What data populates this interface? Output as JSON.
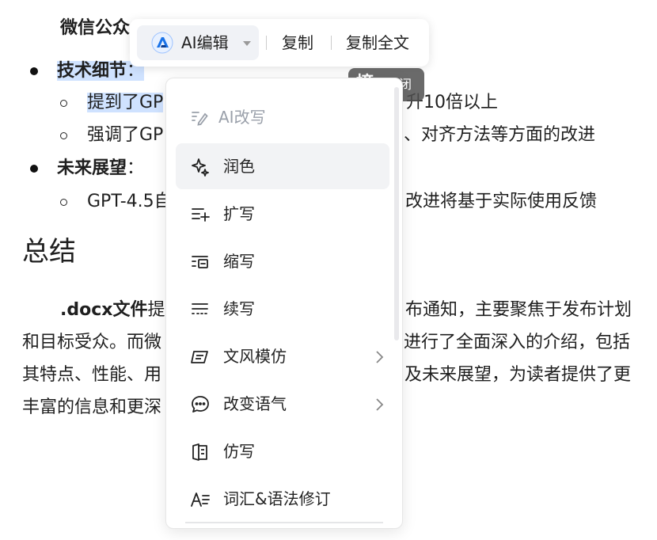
{
  "document": {
    "heading_fragment": "微信公众",
    "bullets": [
      {
        "label": "技术细节",
        "sep": "："
      },
      {
        "label": "未来展望",
        "sep": "："
      }
    ],
    "sub_items": {
      "s1_left": "提到了GP",
      "s1_right": "升10倍以上",
      "s2_left": "强调了GP",
      "s2_right": "、对齐方法等方面的改进",
      "s3_left": "GPT-4.5自",
      "s3_right": "改进将基于实际使用反馈"
    },
    "summary_title": "总结",
    "paragraph": {
      "l1_bold": ".docx文件",
      "l1_mid": "提",
      "l1_right": "布通知，主要聚焦于发布计划",
      "l2_left": "和目标受众。而微",
      "l2_right": "进行了全面深入的介绍，包括",
      "l3_left": "其特点、性能、用",
      "l3_right": "及未来展望，为读者提供了更",
      "l4_left": "丰富的信息和更深"
    }
  },
  "toolbar": {
    "ai_edit_label": "AI编辑",
    "copy_label": "复制",
    "copy_all_label": "复制全文"
  },
  "close_tag": {
    "icon_char": "摘",
    "label": "关闭"
  },
  "menu": {
    "header": "AI改写",
    "items": [
      {
        "label": "润色",
        "icon": "sparkle-icon"
      },
      {
        "label": "扩写",
        "icon": "expand-lines-icon"
      },
      {
        "label": "缩写",
        "icon": "shrink-lines-icon"
      },
      {
        "label": "续写",
        "icon": "continue-lines-icon"
      },
      {
        "label": "文风模仿",
        "icon": "style-imitate-icon",
        "submenu": true
      },
      {
        "label": "改变语气",
        "icon": "chat-bubble-icon",
        "submenu": true
      },
      {
        "label": "仿写",
        "icon": "copy-doc-icon"
      },
      {
        "label": "词汇&语法修订",
        "icon": "grammar-icon"
      }
    ]
  },
  "colors": {
    "highlight": "#cfe2ff",
    "menu_active": "#f2f3f5",
    "brand_blue": "#1a73e8"
  }
}
